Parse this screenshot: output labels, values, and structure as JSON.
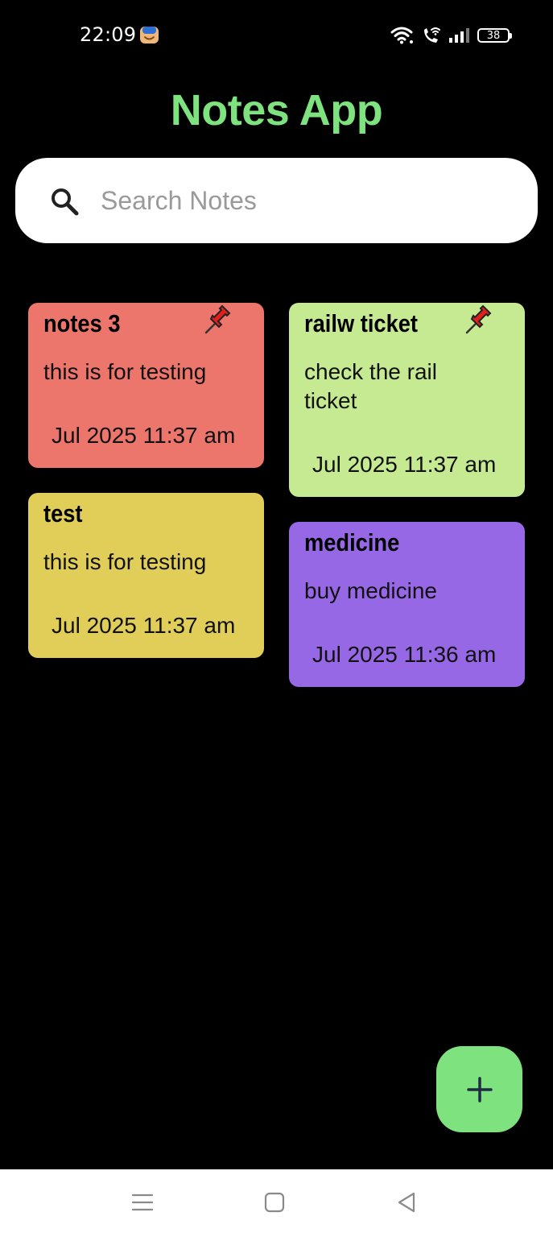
{
  "status_bar": {
    "time": "22:09",
    "battery": "38"
  },
  "header": {
    "title": "Notes App"
  },
  "search": {
    "placeholder": "Search Notes",
    "value": ""
  },
  "notes": [
    {
      "title": "notes 3",
      "body": "this is for testing",
      "date": "Jul 2025 11:37 am",
      "pinned": true,
      "color": "#ec766c"
    },
    {
      "title": "railw ticket",
      "body": "check the rail ticket",
      "date": "Jul 2025 11:37 am",
      "pinned": true,
      "color": "#c6ea91"
    },
    {
      "title": "test",
      "body": "this is for testing",
      "date": "Jul 2025 11:37 am",
      "pinned": false,
      "color": "#e0ce58"
    },
    {
      "title": "medicine",
      "body": "buy medicine",
      "date": "Jul 2025 11:36 am",
      "pinned": false,
      "color": "#9668e6"
    }
  ],
  "fab": {
    "label": "+",
    "icon": "plus-icon",
    "color": "#7ee27e"
  },
  "nav": {
    "items": [
      "menu-icon",
      "home-icon",
      "back-icon"
    ]
  },
  "colors": {
    "title": "#7ee27e",
    "background": "#000000"
  }
}
